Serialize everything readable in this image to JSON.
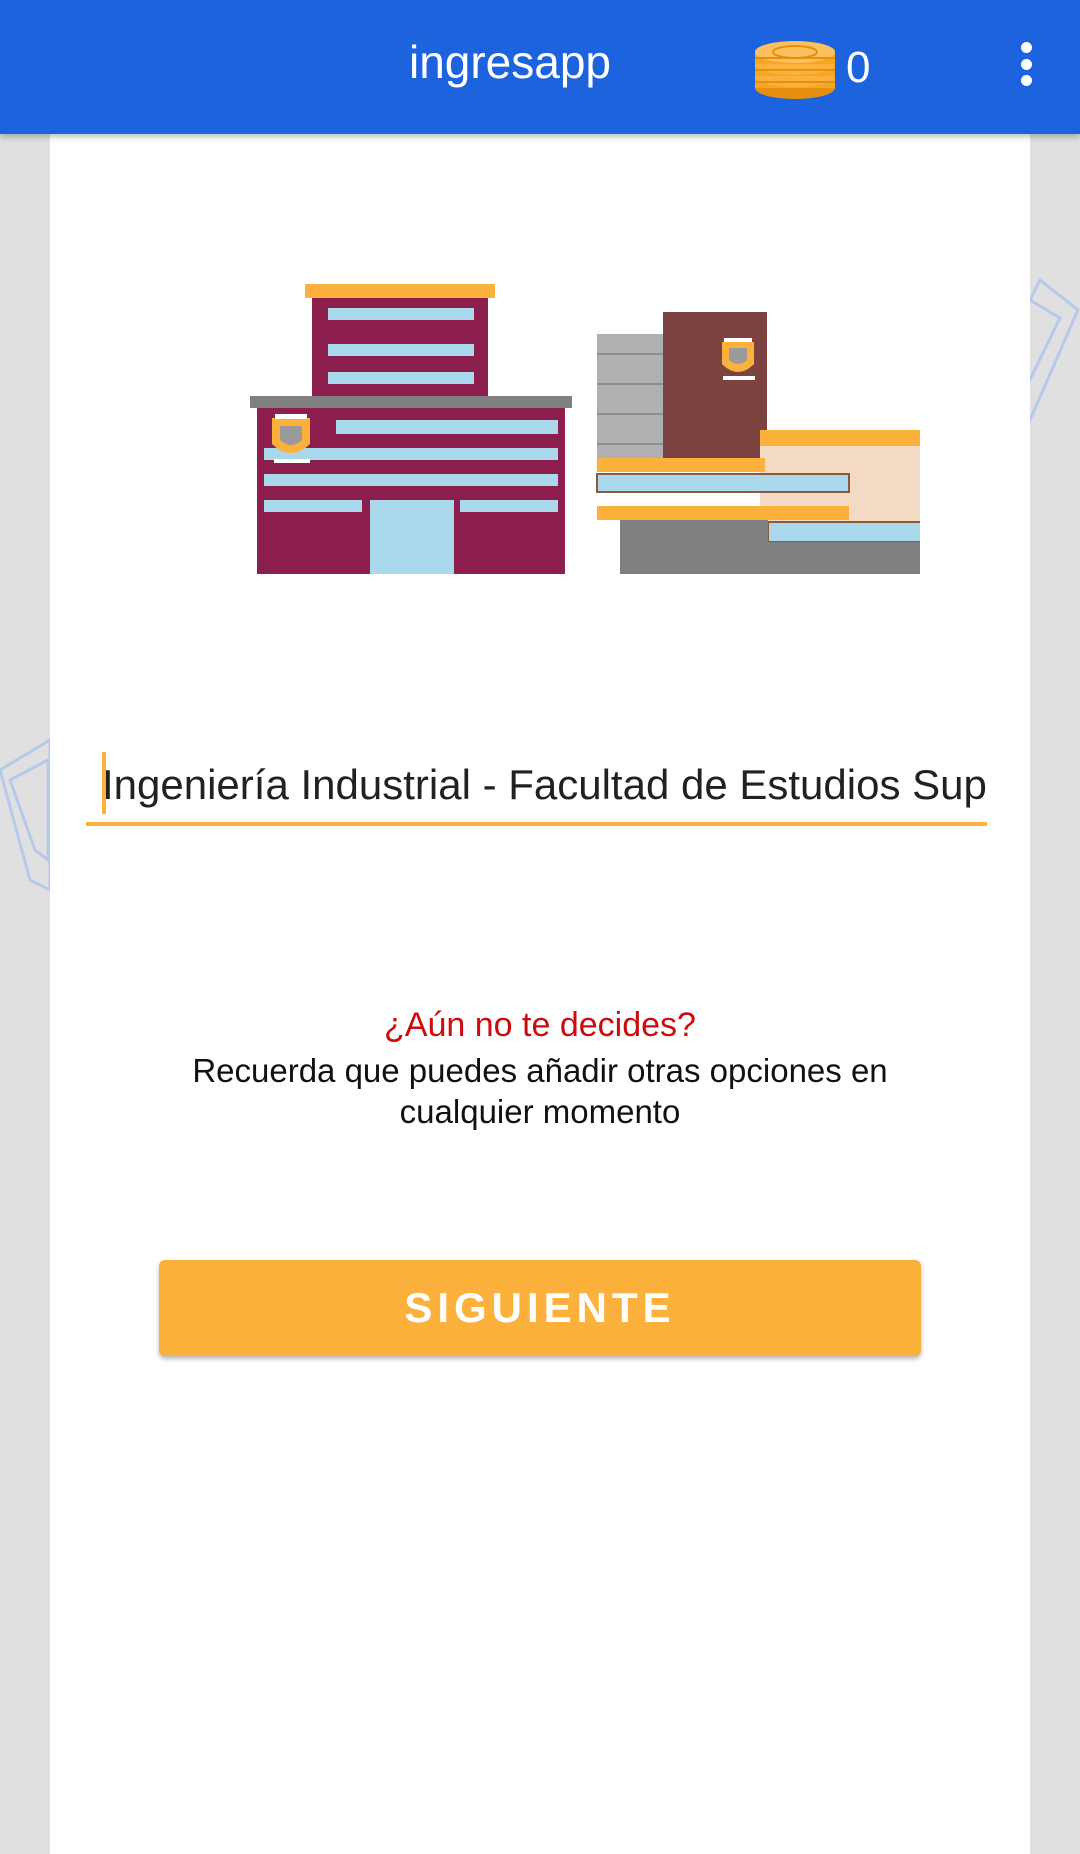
{
  "appbar": {
    "title": "ingresapp",
    "coin_count": "0",
    "coin_icon": "coins-icon",
    "menu_icon": "overflow-menu-icon",
    "color": "#1e63de"
  },
  "career_field": {
    "value": "Ingeniería Industrial - Facultad de Estudios Superiores Aragón",
    "accent_color": "#fbb13c"
  },
  "message": {
    "question": "¿Aún no te decides?",
    "hint": "Recuerda que puedes añadir otras opciones en cualquier momento"
  },
  "next_button": {
    "label": "SIGUIENTE",
    "color": "#fbb13c"
  },
  "illustration": {
    "icon": "university-buildings-icon"
  }
}
